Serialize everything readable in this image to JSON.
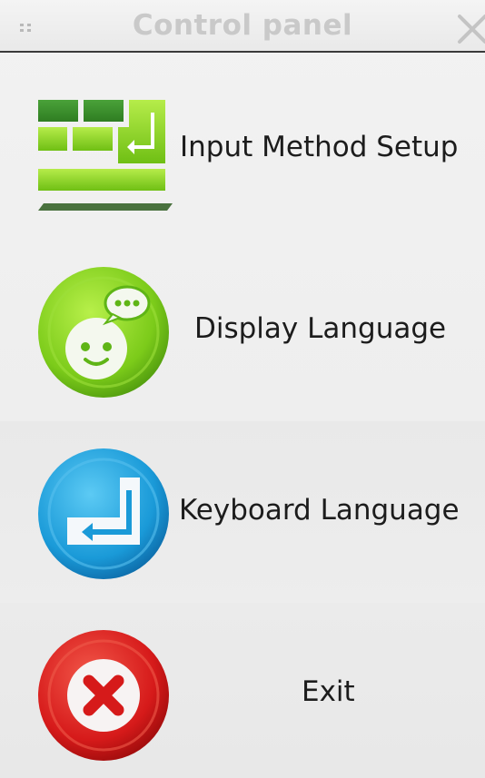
{
  "window": {
    "title": "Control panel"
  },
  "menu": {
    "items": [
      {
        "label": "Input Method Setup",
        "icon": "keyboard-grid-icon"
      },
      {
        "label": "Display Language",
        "icon": "smiley-chat-icon"
      },
      {
        "label": "Keyboard Language",
        "icon": "enter-key-icon"
      },
      {
        "label": "Exit",
        "icon": "exit-x-icon"
      }
    ]
  },
  "colors": {
    "title_text": "#c9c9c9",
    "title_border": "#3a3a3a",
    "green": "#7ccb1a",
    "blue": "#1a9ad8",
    "red": "#d61a1a"
  }
}
